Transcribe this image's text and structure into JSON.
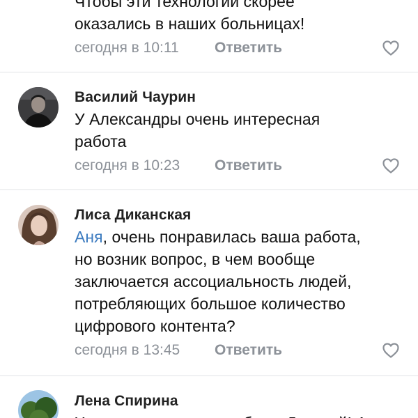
{
  "comments": [
    {
      "author": "",
      "lines": [
        "Чтобы эти технологии скорее",
        "оказались в наших больницах!"
      ],
      "time": "сегодня в 10:11",
      "reply_label": "Ответить",
      "like_icon": "heart-outline-icon"
    },
    {
      "author": "Василий Чаурин",
      "lines": [
        "У Александры очень интересная",
        "работа"
      ],
      "time": "сегодня в 10:23",
      "reply_label": "Ответить",
      "like_icon": "heart-outline-icon"
    },
    {
      "author": "Лиса Диканская",
      "mention": "Аня",
      "lines": [
        ", очень понравилась ваша работа,",
        "но возник вопрос, в чем вообще",
        "заключается ассоциальность людей,",
        "потребляющих большое количество",
        "цифрового контента?"
      ],
      "time": "сегодня в 13:45",
      "reply_label": "Ответить",
      "like_icon": "heart-outline-icon"
    },
    {
      "author": "Лена Спирина",
      "lines": [
        "Хорошая, полезная работа. Дорогой! А"
      ],
      "time": "",
      "reply_label": "",
      "like_icon": ""
    }
  ],
  "colors": {
    "mention": "#3d7cc0",
    "meta": "#8c9198",
    "divider": "#e1e3e6"
  }
}
